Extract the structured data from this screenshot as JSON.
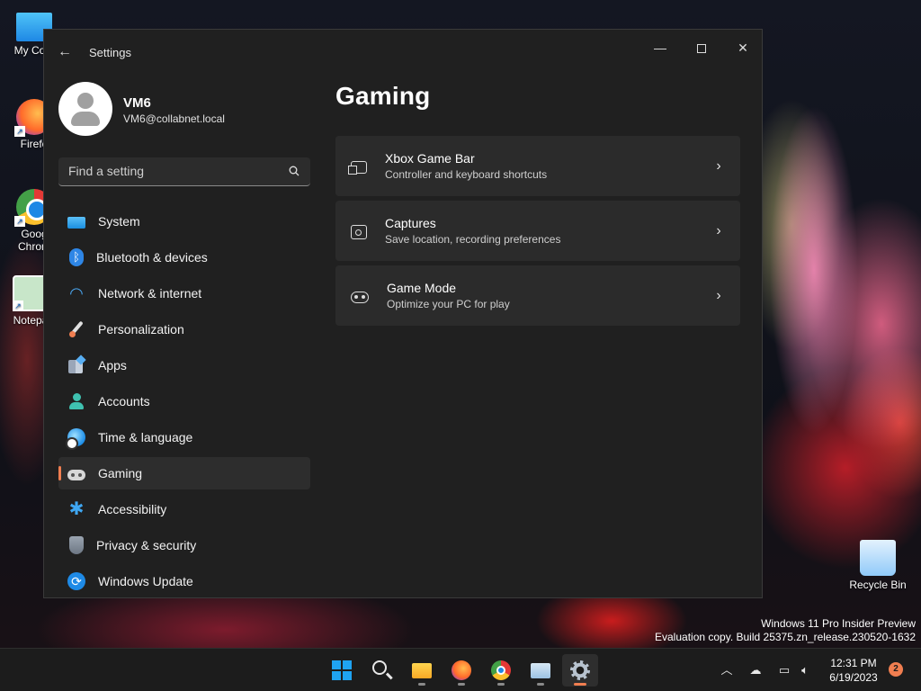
{
  "desktop": {
    "icons": [
      {
        "label": "My Com",
        "icon": "computer-icon"
      },
      {
        "label": "Firefo",
        "icon": "firefox-icon"
      },
      {
        "label": "Goog Chrom",
        "icon": "chrome-icon"
      },
      {
        "label": "Notepa",
        "icon": "notepad-icon"
      },
      {
        "label": "Recycle Bin",
        "icon": "recycle-bin-icon"
      }
    ],
    "watermark": {
      "line1": "Windows 11 Pro Insider Preview",
      "line2": "Evaluation copy. Build 25375.zn_release.230520-1632"
    }
  },
  "window": {
    "title": "Settings",
    "back_icon": "arrow-left-icon",
    "caption_buttons": {
      "minimize": "minimize-icon",
      "maximize": "maximize-icon",
      "close": "close-icon"
    }
  },
  "user": {
    "name": "VM6",
    "email": "VM6@collabnet.local"
  },
  "search": {
    "placeholder": "Find a setting",
    "value": ""
  },
  "nav": {
    "selected": "Gaming",
    "items": [
      {
        "label": "System",
        "icon": "system-icon"
      },
      {
        "label": "Bluetooth & devices",
        "icon": "bluetooth-icon"
      },
      {
        "label": "Network & internet",
        "icon": "network-icon"
      },
      {
        "label": "Personalization",
        "icon": "brush-icon"
      },
      {
        "label": "Apps",
        "icon": "apps-icon"
      },
      {
        "label": "Accounts",
        "icon": "accounts-icon"
      },
      {
        "label": "Time & language",
        "icon": "globe-clock-icon"
      },
      {
        "label": "Gaming",
        "icon": "gamepad-icon"
      },
      {
        "label": "Accessibility",
        "icon": "accessibility-icon"
      },
      {
        "label": "Privacy & security",
        "icon": "shield-icon"
      },
      {
        "label": "Windows Update",
        "icon": "update-icon"
      }
    ]
  },
  "content": {
    "title": "Gaming",
    "cards": [
      {
        "title": "Xbox Game Bar",
        "subtitle": "Controller and keyboard shortcuts",
        "icon": "game-bar-icon"
      },
      {
        "title": "Captures",
        "subtitle": "Save location, recording preferences",
        "icon": "capture-icon"
      },
      {
        "title": "Game Mode",
        "subtitle": "Optimize your PC for play",
        "icon": "game-mode-icon"
      }
    ]
  },
  "taskbar": {
    "apps": [
      "start-icon",
      "search-icon",
      "file-explorer-icon",
      "firefox-icon",
      "chrome-icon",
      "monitor-app-icon",
      "settings-icon"
    ],
    "active_app": "settings-icon",
    "time": "12:31 PM",
    "date": "6/19/2023",
    "notification_count": "2"
  },
  "colors": {
    "accent": "#f07e50",
    "window_bg": "#202020",
    "card_bg": "#2b2b2b",
    "taskbar_bg": "#1c1c1c"
  }
}
